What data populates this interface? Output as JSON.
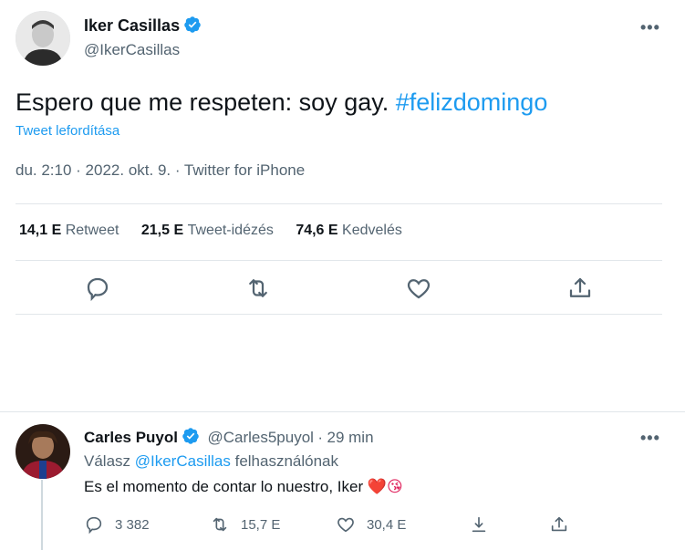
{
  "tweet": {
    "author_name": "Iker Casillas",
    "author_handle": "@IkerCasillas",
    "text_plain": "Espero que me respeten: soy gay. ",
    "text_hashtag": "#felizdomingo",
    "translate_label": "Tweet lefordítása",
    "timestamp": "du. 2:10 · 2022. okt. 9. · Twitter for iPhone",
    "stats": {
      "retweets_num": "14,1 E",
      "retweets_label": "Retweet",
      "quotes_num": "21,5 E",
      "quotes_label": "Tweet-idézés",
      "likes_num": "74,6 E",
      "likes_label": "Kedvelés"
    },
    "more_label": "•••"
  },
  "reply": {
    "author_name": "Carles Puyol",
    "author_handle": "@Carles5puyol",
    "separator": "·",
    "time": "29 min",
    "replying_prefix": "Válasz ",
    "replying_mention": "@IkerCasillas",
    "replying_suffix": " felhasználónak",
    "text": "Es el momento de contar lo nuestro, Iker ",
    "emojis": "❤️😘",
    "reply_count": "3 382",
    "retweet_count": "15,7 E",
    "like_count": "30,4 E",
    "more_label": "•••"
  },
  "colors": {
    "accent": "#1d9bf0",
    "text": "#0f1419",
    "muted": "#536471",
    "divider": "#e1e6ea"
  }
}
